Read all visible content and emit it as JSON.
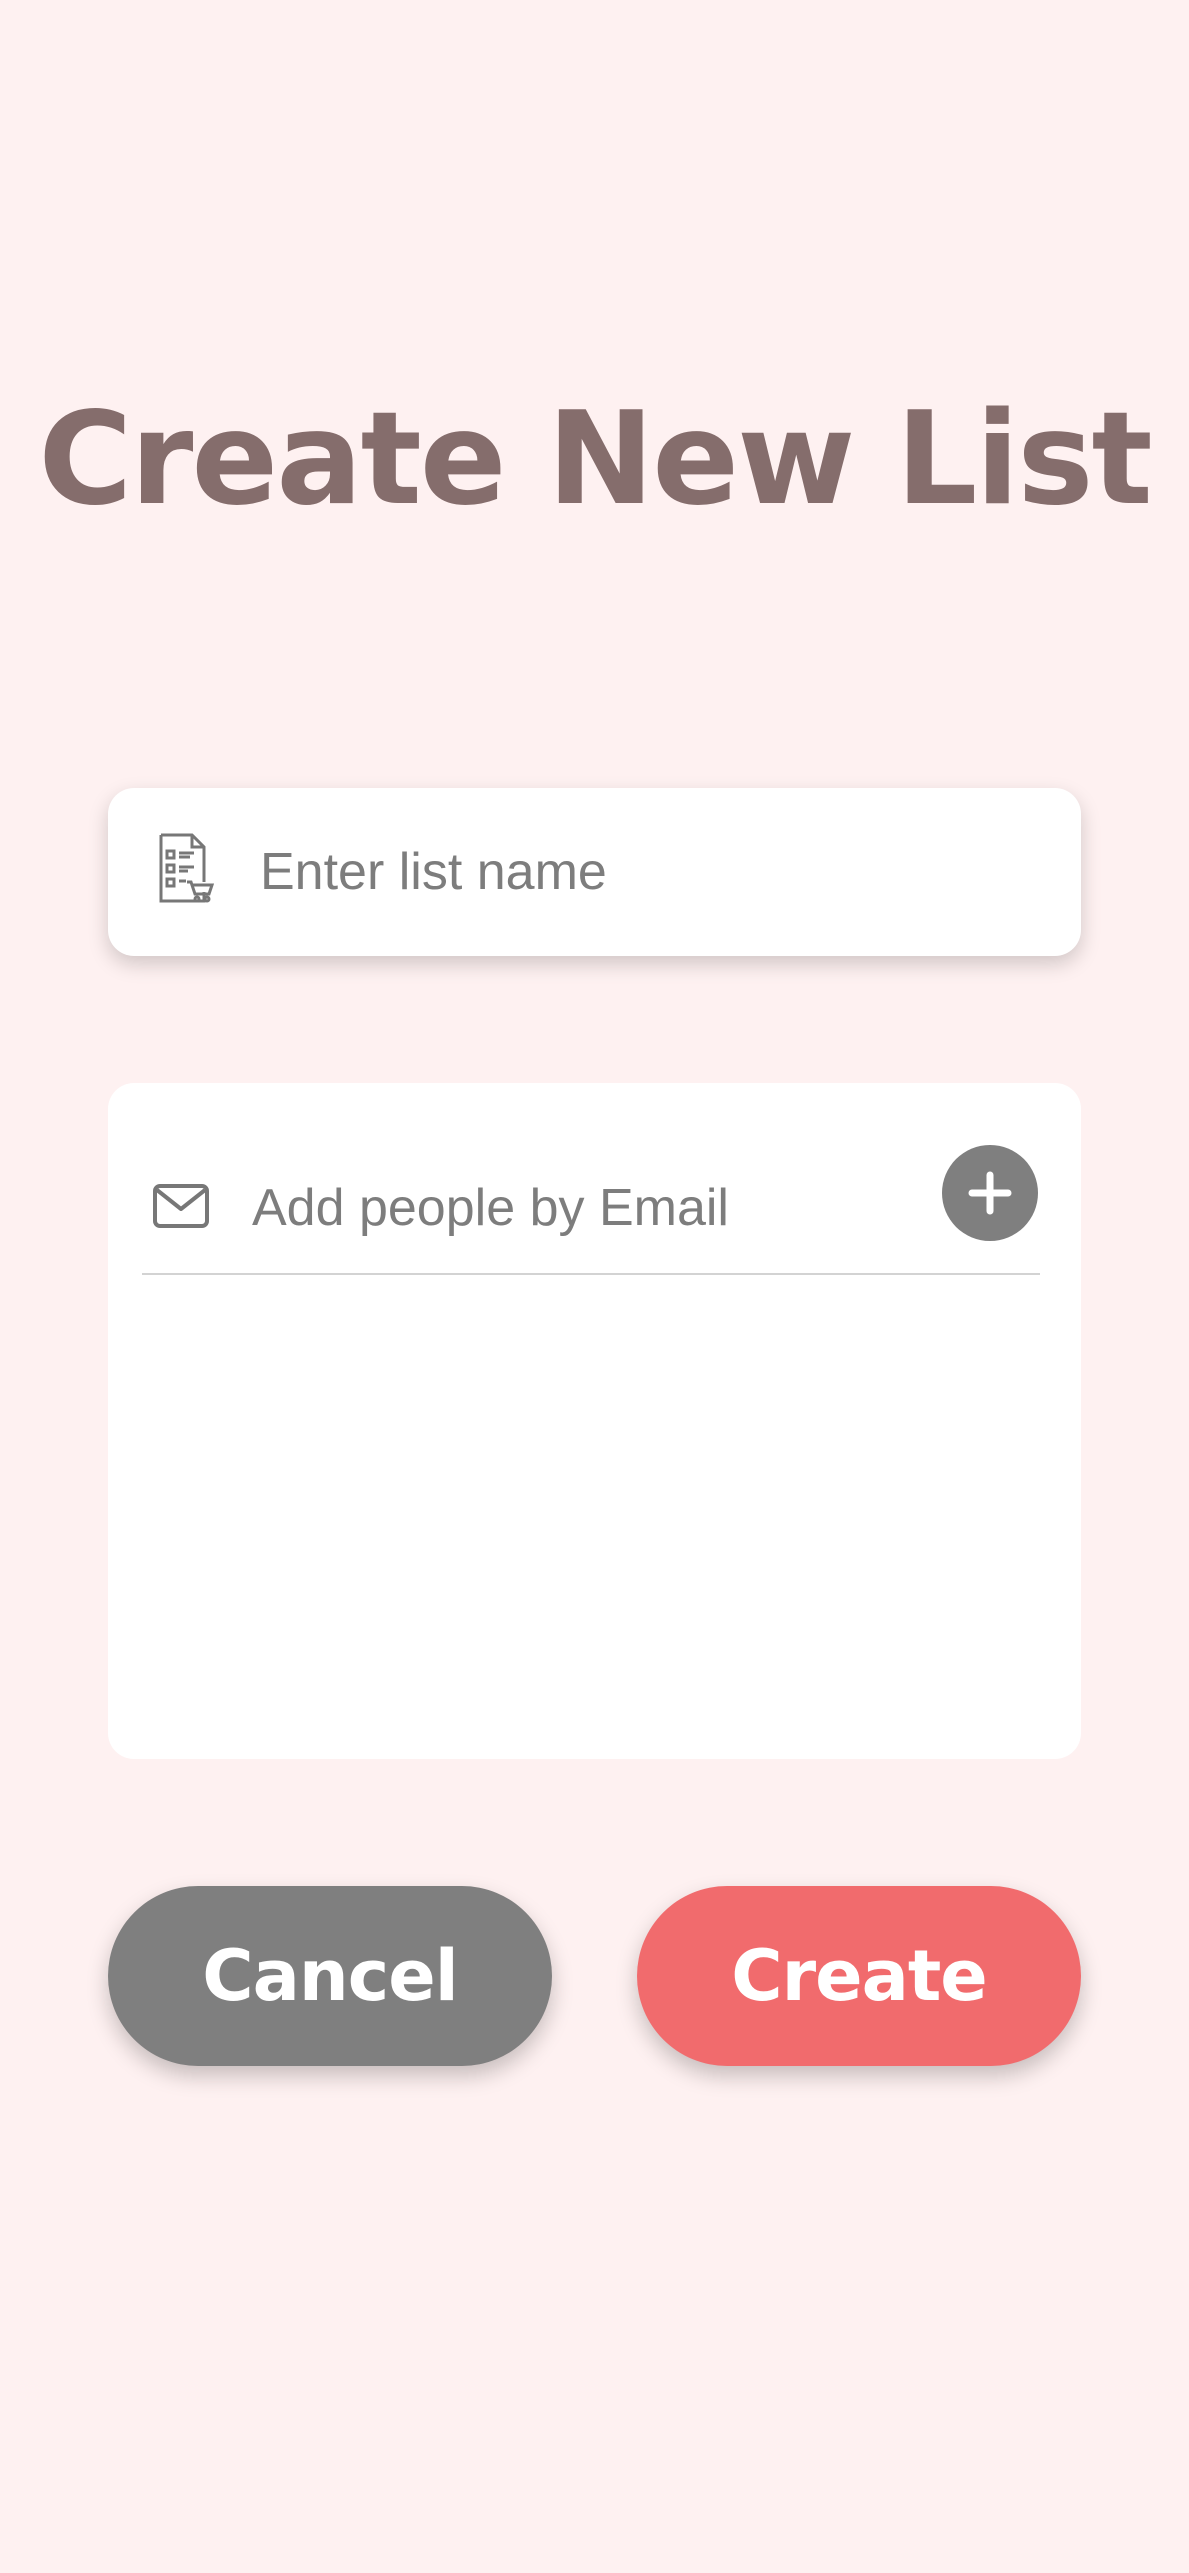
{
  "header": {
    "title": "Create New List"
  },
  "list_name": {
    "icon": "shopping-list-icon",
    "value": "",
    "placeholder": "Enter list name"
  },
  "people": {
    "icon": "mail-icon",
    "value": "",
    "placeholder": "Add people by Email",
    "add_icon": "plus-icon",
    "members": []
  },
  "actions": {
    "cancel_label": "Cancel",
    "create_label": "Create"
  },
  "colors": {
    "background": "#fef1f1",
    "title": "#856d6c",
    "cancel": "#7f7f7f",
    "create": "#f16b6d"
  }
}
